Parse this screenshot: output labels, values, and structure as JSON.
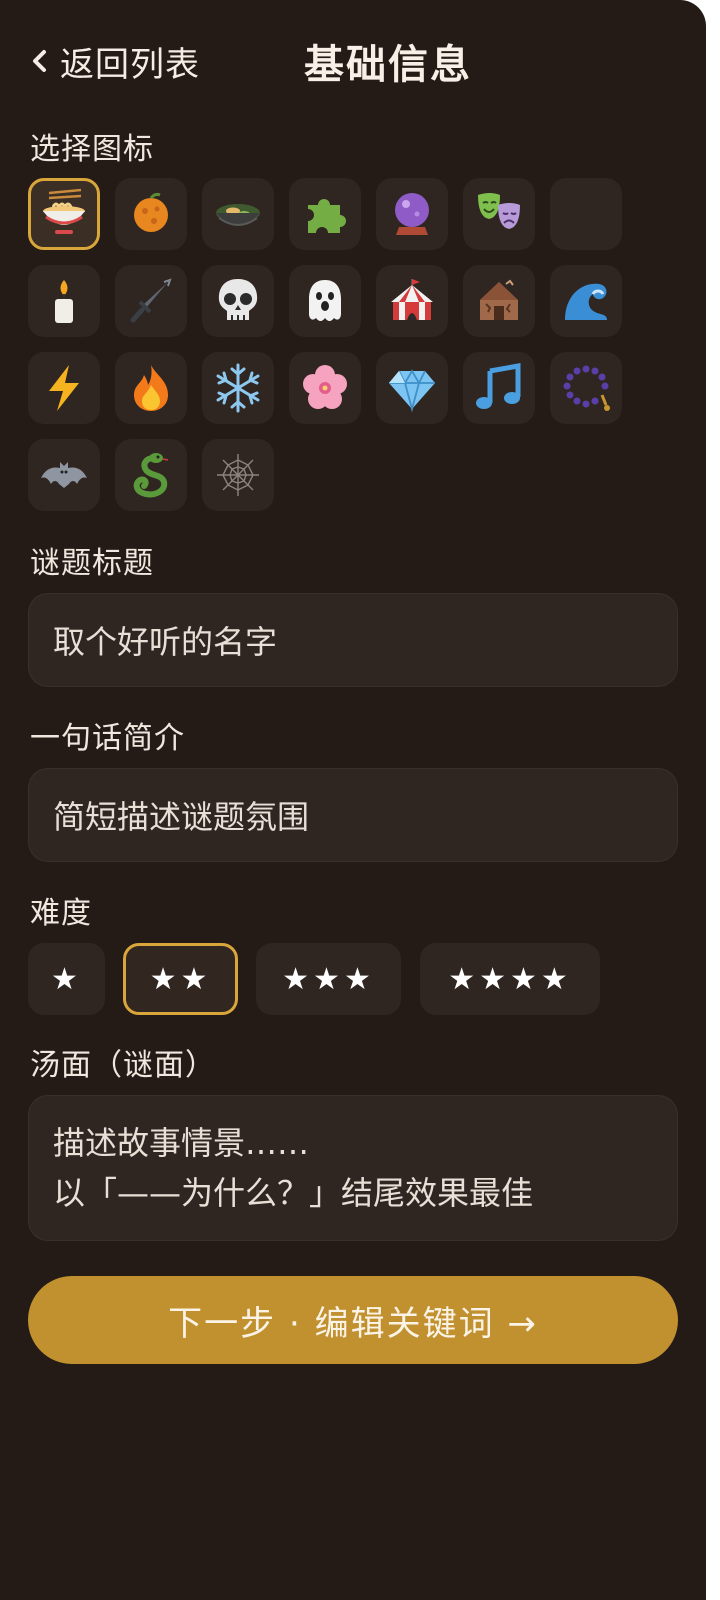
{
  "header": {
    "back_label": "返回列表",
    "title": "基础信息"
  },
  "icon_section": {
    "label": "选择图标",
    "selected_index": 0,
    "icons": [
      "noodle-bowl-icon",
      "orange-icon",
      "stew-pot-icon",
      "puzzle-piece-icon",
      "crystal-ball-icon",
      "theater-masks-icon",
      "crescent-moon-icon",
      "candle-icon",
      "dagger-icon",
      "skull-icon",
      "ghost-icon",
      "circus-tent-icon",
      "ruined-house-icon",
      "wave-icon",
      "lightning-icon",
      "fire-icon",
      "snowflake-icon",
      "cherry-blossom-icon",
      "gem-icon",
      "music-note-icon",
      "prayer-beads-icon",
      "bat-icon",
      "snake-icon",
      "spider-web-icon"
    ]
  },
  "title_field": {
    "label": "谜题标题",
    "placeholder": "取个好听的名字"
  },
  "summary_field": {
    "label": "一句话简介",
    "placeholder": "简短描述谜题氛围"
  },
  "difficulty": {
    "label": "难度",
    "selected_index": 1,
    "options": [
      "★",
      "★★",
      "★★★",
      "★★★★"
    ]
  },
  "surface_field": {
    "label": "汤面（谜面）",
    "placeholder_line1": "描述故事情景……",
    "placeholder_line2": "以「——为什么？」结尾效果最佳"
  },
  "next_button": {
    "label": "下一步 · 编辑关键词 →"
  },
  "colors": {
    "background": "#241b17",
    "accent": "#c1902f",
    "selected_border": "#d9a63c"
  }
}
